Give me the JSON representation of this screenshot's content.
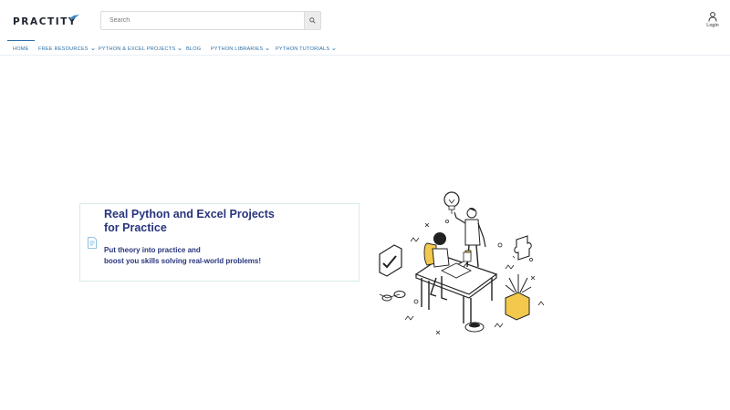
{
  "brand": {
    "logo_text": "PRACTITY"
  },
  "search": {
    "placeholder": "Search"
  },
  "account": {
    "login_label": "Login"
  },
  "nav": {
    "items": [
      {
        "label": "HOME",
        "has_dropdown": false,
        "active": true
      },
      {
        "label": "FREE RESOURCES",
        "has_dropdown": true
      },
      {
        "label": "PYTHON & EXCEL PROJECTS",
        "has_dropdown": true
      },
      {
        "label": "BLOG",
        "has_dropdown": false
      },
      {
        "label": "PYTHON LIBRARIES",
        "has_dropdown": true
      },
      {
        "label": "PYTHON TUTORIALS",
        "has_dropdown": true
      }
    ]
  },
  "hero": {
    "title_line1": "Real Python and Excel Projects",
    "title_line2": "for Practice",
    "subtitle_line1": "Put theory into practice and",
    "subtitle_line2": "boost you skills solving real-world problems!"
  },
  "colors": {
    "nav_link": "#2c6fa6",
    "hero_text": "#28357d",
    "card_border": "#d8ece8",
    "accent_yellow": "#f2c94c"
  }
}
